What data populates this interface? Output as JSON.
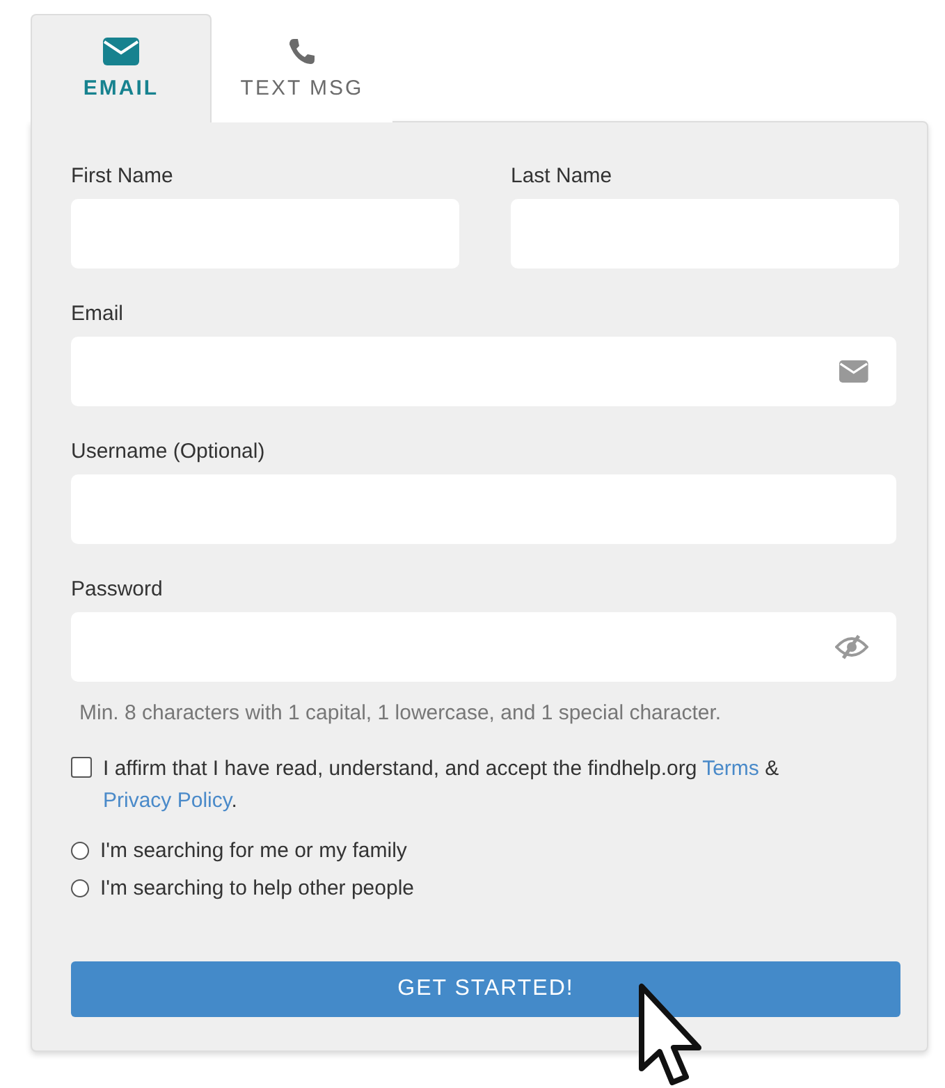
{
  "tabs": [
    {
      "label": "EMAIL",
      "kind": "email",
      "selected": true
    },
    {
      "label": "TEXT MSG",
      "kind": "sms",
      "selected": false
    }
  ],
  "name_fields": [
    {
      "label": "First Name"
    },
    {
      "label": "Last Name"
    }
  ],
  "fields": [
    {
      "label": "Email",
      "kind": "email"
    },
    {
      "label": "Username (Optional)",
      "kind": "text"
    },
    {
      "label": "Password",
      "kind": "password",
      "hint": "Min. 8 characters with 1 capital, 1 lowercase, and 1 special character."
    }
  ],
  "agreement": {
    "checked": false,
    "text": "I affirm that I have read, understand, and accept the findhelp.org",
    "terms_link": "Terms",
    "joiner": "&",
    "privacy_link": "Privacy Policy",
    "end": "."
  },
  "options": [
    {
      "label": "I'm searching for me or my family",
      "selected": false
    },
    {
      "label": "I'm searching to help other people",
      "selected": false
    }
  ],
  "submit": {
    "label": "GET STARTED!"
  }
}
